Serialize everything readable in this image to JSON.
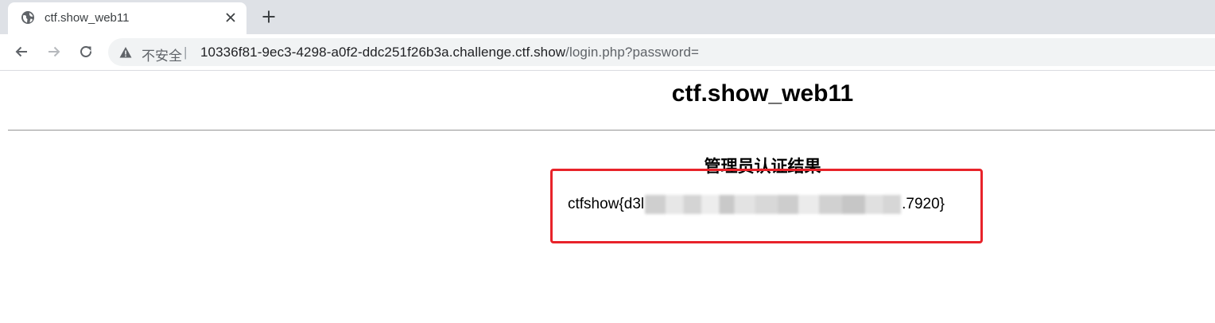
{
  "browser": {
    "tab": {
      "title": "ctf.show_web11",
      "favicon": "globe-icon",
      "close_icon": "close-icon"
    },
    "new_tab_icon": "plus-icon",
    "toolbar": {
      "back_icon": "arrow-left-icon",
      "forward_icon": "arrow-right-icon",
      "reload_icon": "reload-icon"
    },
    "address_bar": {
      "security_icon": "warning-triangle-icon",
      "security_label": "不安全",
      "separator": "|",
      "url_host": "10336f81-9ec3-4298-a0f2-ddc251f26b3a.challenge.ctf.show",
      "url_path": "/login.php?password="
    }
  },
  "page": {
    "title": "ctf.show_web11",
    "subheading": "管理员认证结果",
    "result_prefix": "ctfshow{d3l",
    "result_suffix": ".7920}"
  },
  "colors": {
    "tabbar_bg": "#dee1e6",
    "omnibox_bg": "#f1f3f4",
    "highlight_border": "#e8232a"
  }
}
